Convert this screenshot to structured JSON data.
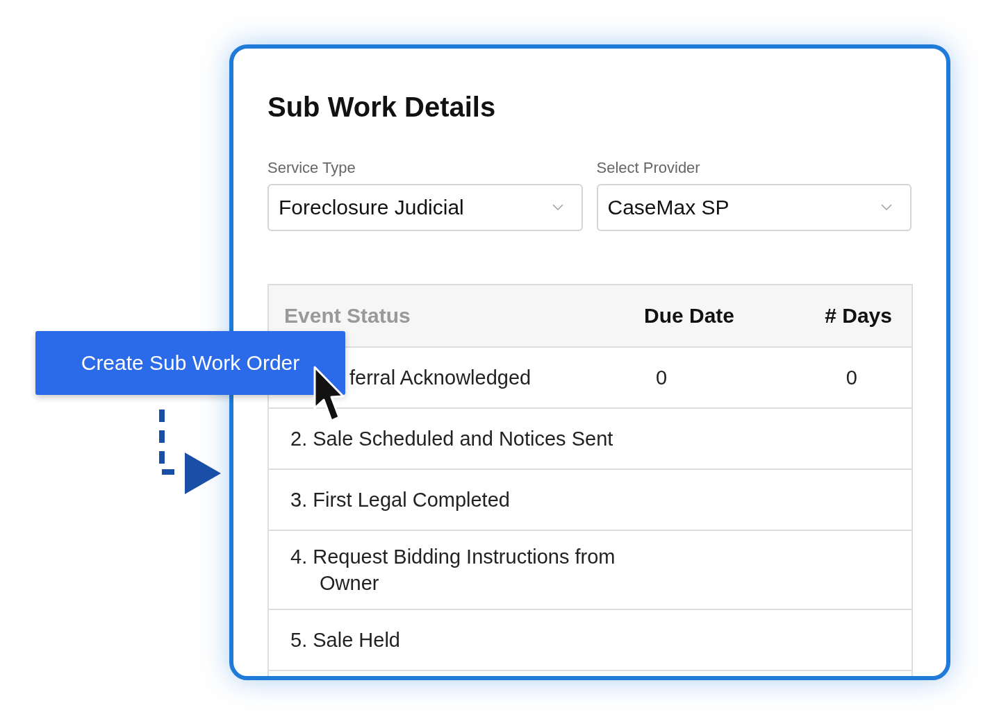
{
  "panel": {
    "title": "Sub Work Details"
  },
  "fields": [
    {
      "label": "Service Type",
      "value": "Foreclosure Judicial"
    },
    {
      "label": "Select Provider",
      "value": "CaseMax SP"
    }
  ],
  "table": {
    "columns": [
      "Event Status",
      "Due Date",
      "# Days"
    ],
    "rows": [
      {
        "event": "ferral Acknowledged",
        "due_date": "0",
        "days": "0"
      },
      {
        "event": "2. Sale Scheduled and Notices Sent"
      },
      {
        "event": "3. First Legal Completed"
      },
      {
        "event": "4. Request Bidding Instructions from Owner"
      },
      {
        "event": "5. Sale Held"
      }
    ]
  },
  "action_button": {
    "label": "Create Sub Work Order"
  }
}
